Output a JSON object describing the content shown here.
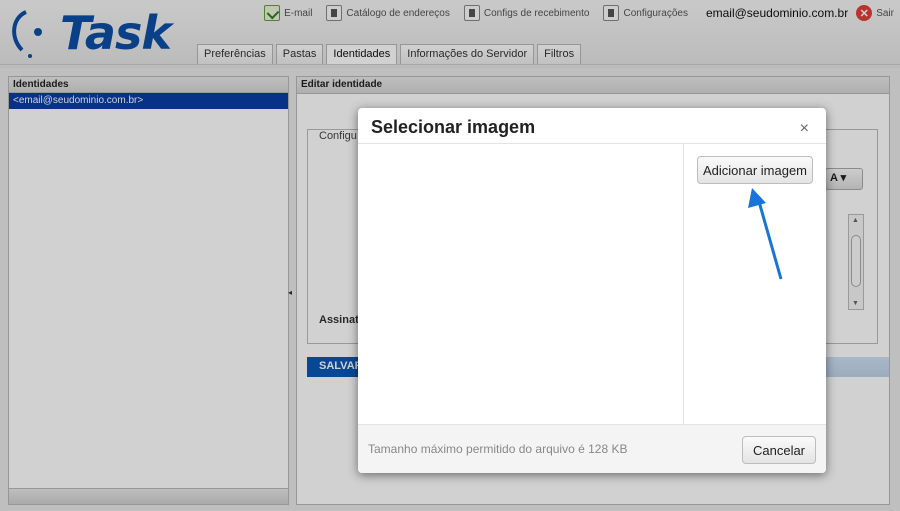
{
  "header": {
    "logo_text": "Task",
    "nav": [
      {
        "label": "E-mail",
        "icon": "mail-icon"
      },
      {
        "label": "Catálogo de endereços",
        "icon": "address-book-icon"
      },
      {
        "label": "Configs de recebimento",
        "icon": "receive-settings-icon"
      },
      {
        "label": "Configurações",
        "icon": "settings-icon"
      }
    ],
    "user_email": "email@seudominio.com.br",
    "logout_label": "Sair"
  },
  "tabs": [
    "Preferências",
    "Pastas",
    "Identidades",
    "Informações do Servidor",
    "Filtros"
  ],
  "active_tab": "Identidades",
  "left_panel": {
    "title": "Identidades",
    "items": [
      "<email@seudominio.com.br>"
    ]
  },
  "right_panel": {
    "title": "Editar identidade",
    "config_label": "Configu",
    "signature_label": "Assinat",
    "format_button": "A",
    "save_label": "SALVAR"
  },
  "modal": {
    "title": "Selecionar imagem",
    "close": "×",
    "add_image_label": "Adicionar imagem",
    "footer_note": "Tamanho máximo permitido do arquivo é 128 KB",
    "cancel_label": "Cancelar"
  },
  "colors": {
    "brand": "#0d4fa6",
    "selection": "#0a3ea7",
    "save_button": "#0a57b6",
    "arrow": "#1a73d9"
  }
}
